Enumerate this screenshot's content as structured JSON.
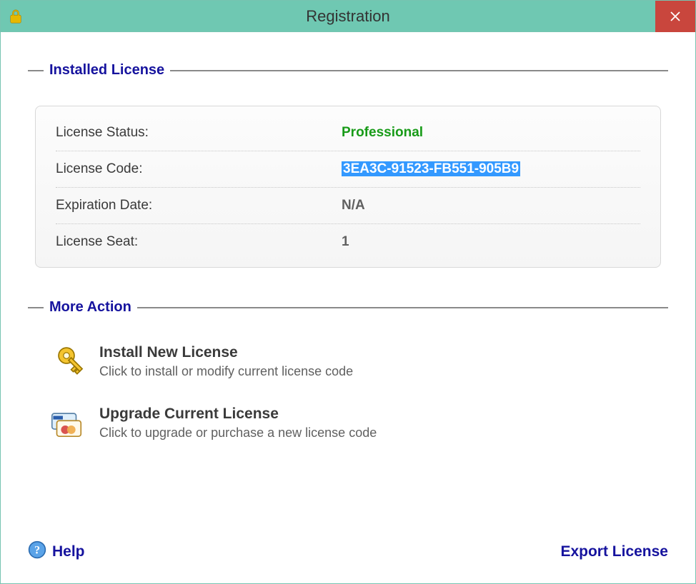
{
  "window": {
    "title": "Registration"
  },
  "installed": {
    "group_title": "Installed License",
    "status_label": "License Status:",
    "status_value": "Professional",
    "code_label": "License Code:",
    "code_value": "3EA3C-91523-FB551-905B9",
    "expiration_label": "Expiration Date:",
    "expiration_value": "N/A",
    "seat_label": "License Seat:",
    "seat_value": "1"
  },
  "more_action": {
    "group_title": "More Action",
    "install": {
      "title": "Install New License",
      "desc": "Click to install or modify current license code"
    },
    "upgrade": {
      "title": "Upgrade Current License",
      "desc": "Click to upgrade or purchase a new license code"
    }
  },
  "footer": {
    "help_label": "Help",
    "export_label": "Export License"
  }
}
